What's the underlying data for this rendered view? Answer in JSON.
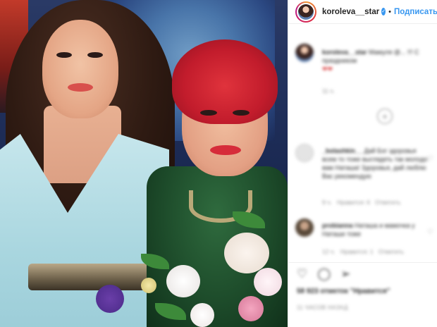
{
  "post": {
    "username": "koroleva__star",
    "separator": "•",
    "follow_label": "Подписаться",
    "verified_icon": "✓"
  },
  "caption": {
    "username": "koroleva__star",
    "text": "Мамуля @... !!! С праздником",
    "emoji": "❤❤",
    "time": "11 ч."
  },
  "load_more_icon": "+",
  "comments": [
    {
      "username": "_bolashkin__",
      "text": "Дай Бог здоровья всем то тоже выглядеть так молодо вам Наташа! Здоровья, дай люблю Вас рекомендую",
      "time": "9 ч.",
      "likes": "Нравится: 6",
      "reply": "Ответить"
    },
    {
      "username": "probianna",
      "text": "Наташа и мамочка у Наташи тоже",
      "time": "12 ч.",
      "likes": "Нравится: 1",
      "reply": "Ответить"
    }
  ],
  "actions": {
    "like_icon": "♡",
    "comment_icon": "◯",
    "share_icon": "➢"
  },
  "likes_text": "58 923 отметок \"Нравится\"",
  "date_text": "11 ЧАСОВ НАЗАД",
  "colors": {
    "accent": "#3897f0",
    "text": "#262626",
    "muted": "#8e8e8e"
  }
}
